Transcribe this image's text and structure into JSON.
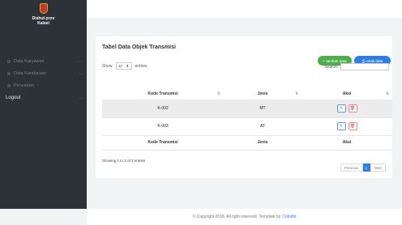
{
  "brand": {
    "line1": "Dishut prov",
    "line2": "Kalsel"
  },
  "sidebar": {
    "items": [
      {
        "label": "Data Karyawan",
        "chevron": "⌄"
      },
      {
        "label": "Data Kendaraan",
        "chevron": "⌄"
      },
      {
        "label": "Pencarian"
      },
      {
        "label": "Logout",
        "chevron": "⌄"
      }
    ]
  },
  "card": {
    "title": "Tabel Data Objek Transmisi",
    "add_button": "+ tambah data",
    "cetak_button": "⎙ cetak data"
  },
  "controls": {
    "show_label": "Show",
    "entries_value": "10",
    "entries_caret": "⬍",
    "entries_label": "entries",
    "search_label": "Search:"
  },
  "table": {
    "headers": [
      "Kode Transmisi",
      "Jenis",
      "Aksi"
    ],
    "sort_icon": "⇅",
    "rows": [
      {
        "kode": "K-002",
        "jenis": "MT"
      },
      {
        "kode": "K-003",
        "jenis": "AT"
      }
    ],
    "edit_icon": "✎",
    "delete_icon": "🗑"
  },
  "info": "Showing 1 to 2 of 2 entries",
  "pagination": {
    "previous": "Previous",
    "current": "1",
    "next": "Next"
  },
  "footer": {
    "text": "© Copyright 2018. All right reserved. Template by",
    "link": "Colorlib"
  },
  "colors": {
    "sidebar": "#2d3238",
    "green": "#4cae4c",
    "blue": "#2f7fe0"
  }
}
